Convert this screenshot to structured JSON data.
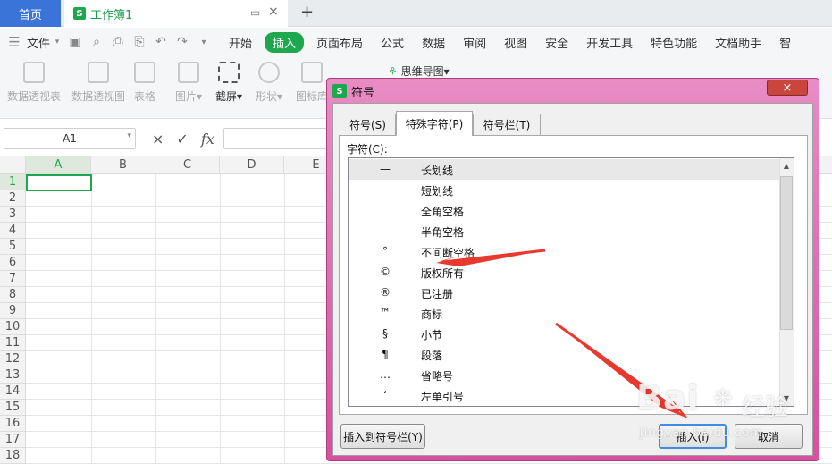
{
  "tabs": {
    "home": "首页",
    "doc_title": "工作簿1",
    "new_tab": "+"
  },
  "menu": {
    "file": "文件",
    "items": [
      "开始",
      "插入",
      "页面布局",
      "公式",
      "数据",
      "审阅",
      "视图",
      "安全",
      "开发工具",
      "特色功能",
      "文档助手",
      "智"
    ],
    "active_index": 1
  },
  "ribbon": {
    "items": [
      "数据透视表",
      "数据透视图",
      "表格",
      "图片",
      "截屏",
      "形状",
      "图标库",
      "思维导图"
    ]
  },
  "formula_bar": {
    "name_box": "A1",
    "fx": "fx",
    "cancel": "×",
    "confirm": "✓"
  },
  "sheet": {
    "columns": [
      "A",
      "B",
      "C",
      "D",
      "E"
    ],
    "rows": [
      "1",
      "2",
      "3",
      "4",
      "5",
      "6",
      "7",
      "8",
      "9",
      "10",
      "11",
      "12",
      "13",
      "14",
      "15",
      "16",
      "17",
      "18"
    ],
    "active_cell": "A1"
  },
  "dialog": {
    "logo": "S",
    "title": "符号",
    "close": "×",
    "tabs": [
      "符号(S)",
      "特殊字符(P)",
      "符号栏(T)"
    ],
    "selected_tab": 1,
    "chars_label": "字符(C):",
    "characters": [
      {
        "symbol": "—",
        "name": "长划线"
      },
      {
        "symbol": "–",
        "name": "短划线"
      },
      {
        "symbol": "",
        "name": "全角空格"
      },
      {
        "symbol": "",
        "name": "半角空格"
      },
      {
        "symbol": "°",
        "name": "不间断空格"
      },
      {
        "symbol": "©",
        "name": "版权所有"
      },
      {
        "symbol": "®",
        "name": "已注册"
      },
      {
        "symbol": "™",
        "name": "商标"
      },
      {
        "symbol": "§",
        "name": "小节"
      },
      {
        "symbol": "¶",
        "name": "段落"
      },
      {
        "symbol": "…",
        "name": "省略号"
      },
      {
        "symbol": "‘",
        "name": "左单引号"
      }
    ],
    "selected_char_index": 0,
    "btn_add_to_bar": "插入到符号栏(Y)",
    "btn_insert": "插入(I)",
    "btn_cancel": "取消"
  },
  "watermark": {
    "brand": "Bai",
    "brand2": "经验",
    "url": "jingyan.baidu.com"
  }
}
